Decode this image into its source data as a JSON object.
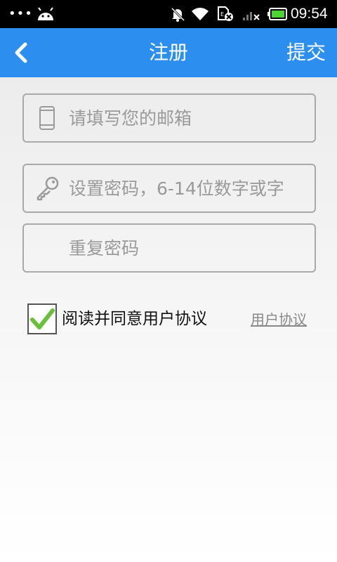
{
  "status_bar": {
    "dots": "•••",
    "time": "09:54",
    "icons": [
      "android-icon",
      "mute-icon",
      "wifi-icon",
      "sim-error-icon",
      "signal-icon",
      "battery-icon"
    ]
  },
  "header": {
    "title": "注册",
    "submit_label": "提交",
    "back_icon": "chevron-left-icon",
    "background_color": "#2c8ff0"
  },
  "form": {
    "email": {
      "placeholder": "请填写您的邮箱",
      "value": "",
      "icon": "phone-icon"
    },
    "password": {
      "placeholder": "设置密码，6-14位数字或字",
      "value": "",
      "icon": "key-icon"
    },
    "confirm_password": {
      "placeholder": "重复密码",
      "value": ""
    }
  },
  "agreement": {
    "checked": true,
    "label": "阅读并同意用户协议",
    "link_label": "用户协议"
  }
}
